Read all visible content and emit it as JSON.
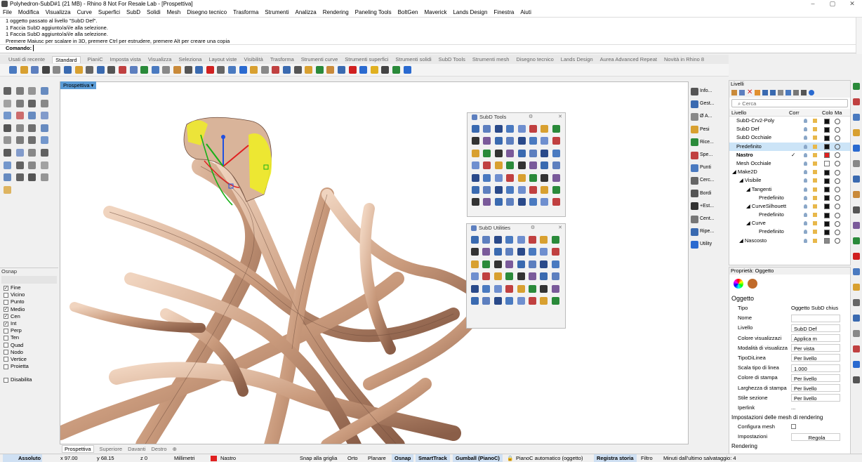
{
  "titlebar": {
    "title": "Polyhedron-SubD#1 (21 MB) - Rhino 8 Not For Resale Lab - [Prospettiva]",
    "minimize": "–",
    "maximize": "▢",
    "close": "✕"
  },
  "menu": [
    "File",
    "Modifica",
    "Visualizza",
    "Curve",
    "Superfici",
    "SubD",
    "Solidi",
    "Mesh",
    "Disegno tecnico",
    "Trasforma",
    "Strumenti",
    "Analizza",
    "Rendering",
    "Paneling Tools",
    "BoltGen",
    "Maverick",
    "Lands Design",
    "Finestra",
    "Aiuti"
  ],
  "command": {
    "history": [
      "1 oggetto passato al livello \"SubD Def\".",
      "1 Faccia SubD aggiunto/a/i/e alla selezione.",
      "1 Faccia SubD aggiunto/a/i/e alla selezione.",
      "Premere Maiusc per scalare in 3D, premere Ctrl per estrudere, premere Alt per creare una copia"
    ],
    "prompt": "Comando:"
  },
  "toolbar_tabs": [
    "Usati di recente",
    "Standard",
    "PianiC",
    "Imposta vista",
    "Visualizza",
    "Seleziona",
    "Layout viste",
    "Visibilità",
    "Trasforma",
    "Strumenti curve",
    "Strumenti superfici",
    "Strumenti solidi",
    "SubD Tools",
    "Strumenti mesh",
    "Disegno tecnico",
    "Lands Design",
    "Aurea Advanced Repeat",
    "Novità in Rhino 8"
  ],
  "toolbar_active": "Standard",
  "viewport": {
    "label": "Prospettiva",
    "dropdown": "▾",
    "tabs": [
      "Prospettiva",
      "Superiore",
      "Davanti",
      "Destro"
    ],
    "add_tab": "⊕"
  },
  "subd_tools": {
    "title": "SubD Tools"
  },
  "subd_utilities": {
    "title": "SubD Utilities"
  },
  "panel_close": "✕",
  "panel_gear": "⚙",
  "side_buttons": [
    "Info...",
    "Gest...",
    "Ø A...",
    "Pesi",
    "Rice...",
    "Spe...",
    "Punti",
    "Cerc...",
    "Bordi",
    "+Est...",
    "Cent...",
    "Ripe...",
    "Utility"
  ],
  "osnap": {
    "title": "Osnap",
    "items": [
      {
        "label": "Fine",
        "checked": true
      },
      {
        "label": "Vicino",
        "checked": false
      },
      {
        "label": "Punto",
        "checked": false
      },
      {
        "label": "Medio",
        "checked": true
      },
      {
        "label": "Cen",
        "checked": true
      },
      {
        "label": "Int",
        "checked": true
      },
      {
        "label": "Perp",
        "checked": false
      },
      {
        "label": "Ten",
        "checked": false
      },
      {
        "label": "Quad",
        "checked": false
      },
      {
        "label": "Nodo",
        "checked": false
      },
      {
        "label": "Vertice",
        "checked": false
      },
      {
        "label": "Proietta",
        "checked": false
      }
    ],
    "disable": "Disabilita",
    "check_mark": "✓"
  },
  "layers": {
    "title": "Livelli",
    "search_placeholder": "Cerca",
    "columns": {
      "name": "Livello",
      "current": "Corr",
      "color": "Colo",
      "material": "Ma"
    },
    "rows": [
      {
        "name": "SubD-Crv2-Poly",
        "indent": 10,
        "color": "#111111",
        "selected": false,
        "bold": false,
        "current": ""
      },
      {
        "name": "SubD Def",
        "indent": 10,
        "color": "#111111",
        "selected": false,
        "bold": false,
        "current": ""
      },
      {
        "name": "SubD Occhiale",
        "indent": 10,
        "color": "#111111",
        "selected": false,
        "bold": false,
        "current": ""
      },
      {
        "name": "Predefinito",
        "indent": 10,
        "color": "#111111",
        "selected": true,
        "bold": false,
        "current": ""
      },
      {
        "name": "Nastro",
        "indent": 10,
        "color": "#e02020",
        "selected": false,
        "bold": true,
        "current": "✓"
      },
      {
        "name": "Mesh Occhiale",
        "indent": 10,
        "color": "#ffffff",
        "selected": false,
        "bold": false,
        "current": ""
      },
      {
        "name": "◢ Make2D",
        "indent": 4,
        "color": "#111111",
        "selected": false,
        "bold": false,
        "current": ""
      },
      {
        "name": "◢ Visibile",
        "indent": 14,
        "color": "#111111",
        "selected": false,
        "bold": false,
        "current": ""
      },
      {
        "name": "◢ Tangenti",
        "indent": 24,
        "color": "#111111",
        "selected": false,
        "bold": false,
        "current": ""
      },
      {
        "name": "Predefinito",
        "indent": 42,
        "color": "#111111",
        "selected": false,
        "bold": false,
        "current": ""
      },
      {
        "name": "◢ CurveSilhouett",
        "indent": 24,
        "color": "#111111",
        "selected": false,
        "bold": false,
        "current": ""
      },
      {
        "name": "Predefinito",
        "indent": 42,
        "color": "#111111",
        "selected": false,
        "bold": false,
        "current": ""
      },
      {
        "name": "◢ Curve",
        "indent": 24,
        "color": "#111111",
        "selected": false,
        "bold": false,
        "current": ""
      },
      {
        "name": "Predefinito",
        "indent": 42,
        "color": "#111111",
        "selected": false,
        "bold": false,
        "current": ""
      },
      {
        "name": "◢ Nascosto",
        "indent": 14,
        "color": "#888888",
        "selected": false,
        "bold": false,
        "current": ""
      }
    ]
  },
  "properties": {
    "title": "Proprietà: Oggetto",
    "section": "Oggetto",
    "rows": [
      {
        "key": "Tipo",
        "value": "Oggetto SubD chius",
        "field": false
      },
      {
        "key": "Nome",
        "value": "",
        "field": true
      },
      {
        "key": "Livello",
        "value": "SubD Def",
        "field": true
      },
      {
        "key": "Colore visualizzazi",
        "value": "Applica m",
        "field": true
      },
      {
        "key": "Modalità di visualizza",
        "value": "Per vista",
        "field": true
      },
      {
        "key": "TipoDiLinea",
        "value": "Per livello",
        "field": true
      },
      {
        "key": "Scala tipo di linea",
        "value": "1.000",
        "field": true
      },
      {
        "key": "Colore di stampa",
        "value": "Per livello",
        "field": true
      },
      {
        "key": "Larghezza di stampa",
        "value": "Per livello",
        "field": true
      },
      {
        "key": "Stile sezione",
        "value": "Per livello",
        "field": true
      },
      {
        "key": "Iperlink",
        "value": "...",
        "field": false
      }
    ],
    "mesh_section": "Impostazioni delle mesh di rendering",
    "configura": "Configura mesh",
    "impostazioni": "Impostazioni",
    "regola": "Regola",
    "rendering": "Rendering"
  },
  "status": {
    "absolute": "Assoluto",
    "x": "x 97.00",
    "y": "y 68.15",
    "z": "z 0",
    "units": "Millimetri",
    "layer": "Nastro",
    "layer_color": "#e02020",
    "snap": "Snap alla griglia",
    "orto": "Orto",
    "planare": "Planare",
    "osnap": "Osnap",
    "smarttrack": "SmartTrack",
    "gumball": "Gumball (PianoC)",
    "pianoc": "PianoC automatico (oggetto)",
    "storia": "Registra storia",
    "filtro": "Filtro",
    "saved": "Minuti dall'ultimo salvataggio: 4"
  }
}
